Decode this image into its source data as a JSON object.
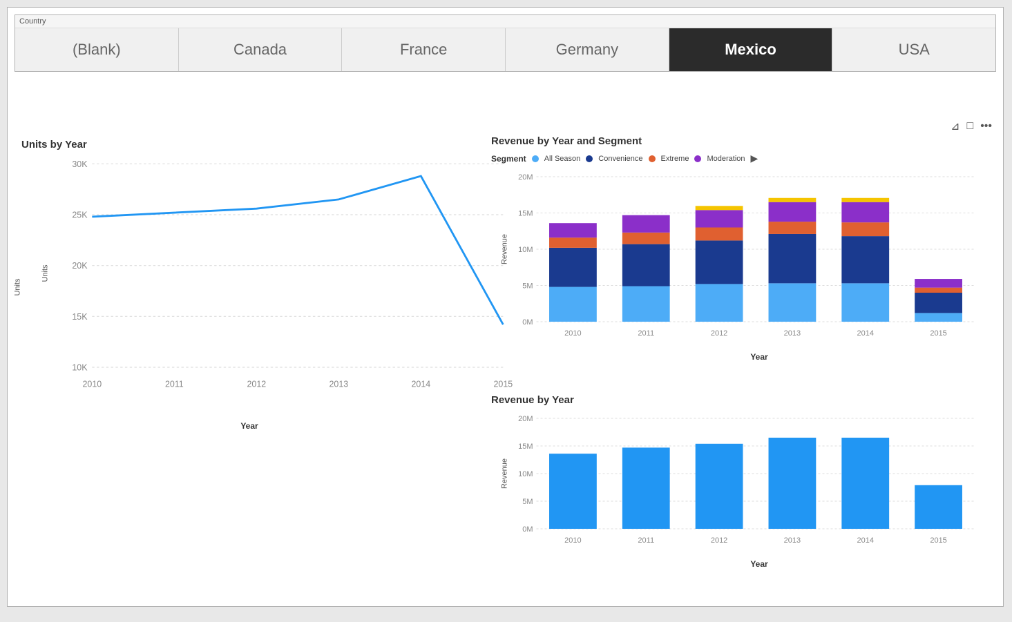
{
  "slicer": {
    "label": "Country",
    "buttons": [
      {
        "id": "blank",
        "label": "(Blank)",
        "active": false
      },
      {
        "id": "canada",
        "label": "Canada",
        "active": false
      },
      {
        "id": "france",
        "label": "France",
        "active": false
      },
      {
        "id": "germany",
        "label": "Germany",
        "active": false
      },
      {
        "id": "mexico",
        "label": "Mexico",
        "active": true
      },
      {
        "id": "usa",
        "label": "USA",
        "active": false
      }
    ]
  },
  "toolbar": {
    "filter_icon": "▽",
    "expand_icon": "⛶",
    "more_icon": "···"
  },
  "units_chart": {
    "title": "Units by Year",
    "y_label": "Units",
    "x_label": "Year",
    "y_axis": [
      "30K",
      "25K",
      "20K",
      "15K",
      "10K"
    ],
    "x_axis": [
      "2010",
      "2011",
      "2012",
      "2013",
      "2014",
      "2015"
    ],
    "data": [
      {
        "year": "2010",
        "value": 24800
      },
      {
        "year": "2011",
        "value": 25200
      },
      {
        "year": "2012",
        "value": 25600
      },
      {
        "year": "2013",
        "value": 26500
      },
      {
        "year": "2014",
        "value": 28800
      },
      {
        "year": "2015",
        "value": 14200
      }
    ],
    "min": 10000,
    "max": 30000
  },
  "rev_segment_chart": {
    "title": "Revenue by Year and Segment",
    "segment_label": "Segment",
    "y_label": "Revenue",
    "x_label": "Year",
    "y_axis": [
      "20M",
      "15M",
      "10M",
      "5M",
      "0M"
    ],
    "x_axis": [
      "2010",
      "2011",
      "2012",
      "2013",
      "2014",
      "2015"
    ],
    "legend": [
      {
        "label": "All Season",
        "color": "#4dacf7"
      },
      {
        "label": "Convenience",
        "color": "#1a3a8f"
      },
      {
        "label": "Extreme",
        "color": "#e06030"
      },
      {
        "label": "Moderation",
        "color": "#8b2fc9"
      }
    ],
    "data": [
      {
        "year": "2010",
        "allSeason": 4800000,
        "convenience": 5400000,
        "extreme": 1400000,
        "moderation": 2000000
      },
      {
        "year": "2011",
        "allSeason": 4900000,
        "convenience": 5800000,
        "extreme": 1600000,
        "moderation": 2400000
      },
      {
        "year": "2012",
        "allSeason": 5200000,
        "convenience": 6000000,
        "extreme": 1800000,
        "moderation": 2400000
      },
      {
        "year": "2013",
        "allSeason": 5300000,
        "convenience": 6800000,
        "extreme": 1700000,
        "moderation": 2700000
      },
      {
        "year": "2014",
        "allSeason": 5300000,
        "convenience": 6500000,
        "extreme": 1900000,
        "moderation": 2800000
      },
      {
        "year": "2015",
        "allSeason": 1200000,
        "convenience": 2800000,
        "extreme": 700000,
        "moderation": 1200000
      }
    ],
    "max": 20000000
  },
  "rev_year_chart": {
    "title": "Revenue by Year",
    "y_label": "Revenue",
    "x_label": "Year",
    "y_axis": [
      "20M",
      "15M",
      "10M",
      "5M",
      "0M"
    ],
    "x_axis": [
      "2010",
      "2011",
      "2012",
      "2013",
      "2014",
      "2015"
    ],
    "color": "#2196f3",
    "data": [
      {
        "year": "2010",
        "value": 13600000
      },
      {
        "year": "2011",
        "value": 14700000
      },
      {
        "year": "2012",
        "value": 15400000
      },
      {
        "year": "2013",
        "value": 16500000
      },
      {
        "year": "2014",
        "value": 16500000
      },
      {
        "year": "2015",
        "value": 7900000
      }
    ],
    "max": 20000000
  }
}
